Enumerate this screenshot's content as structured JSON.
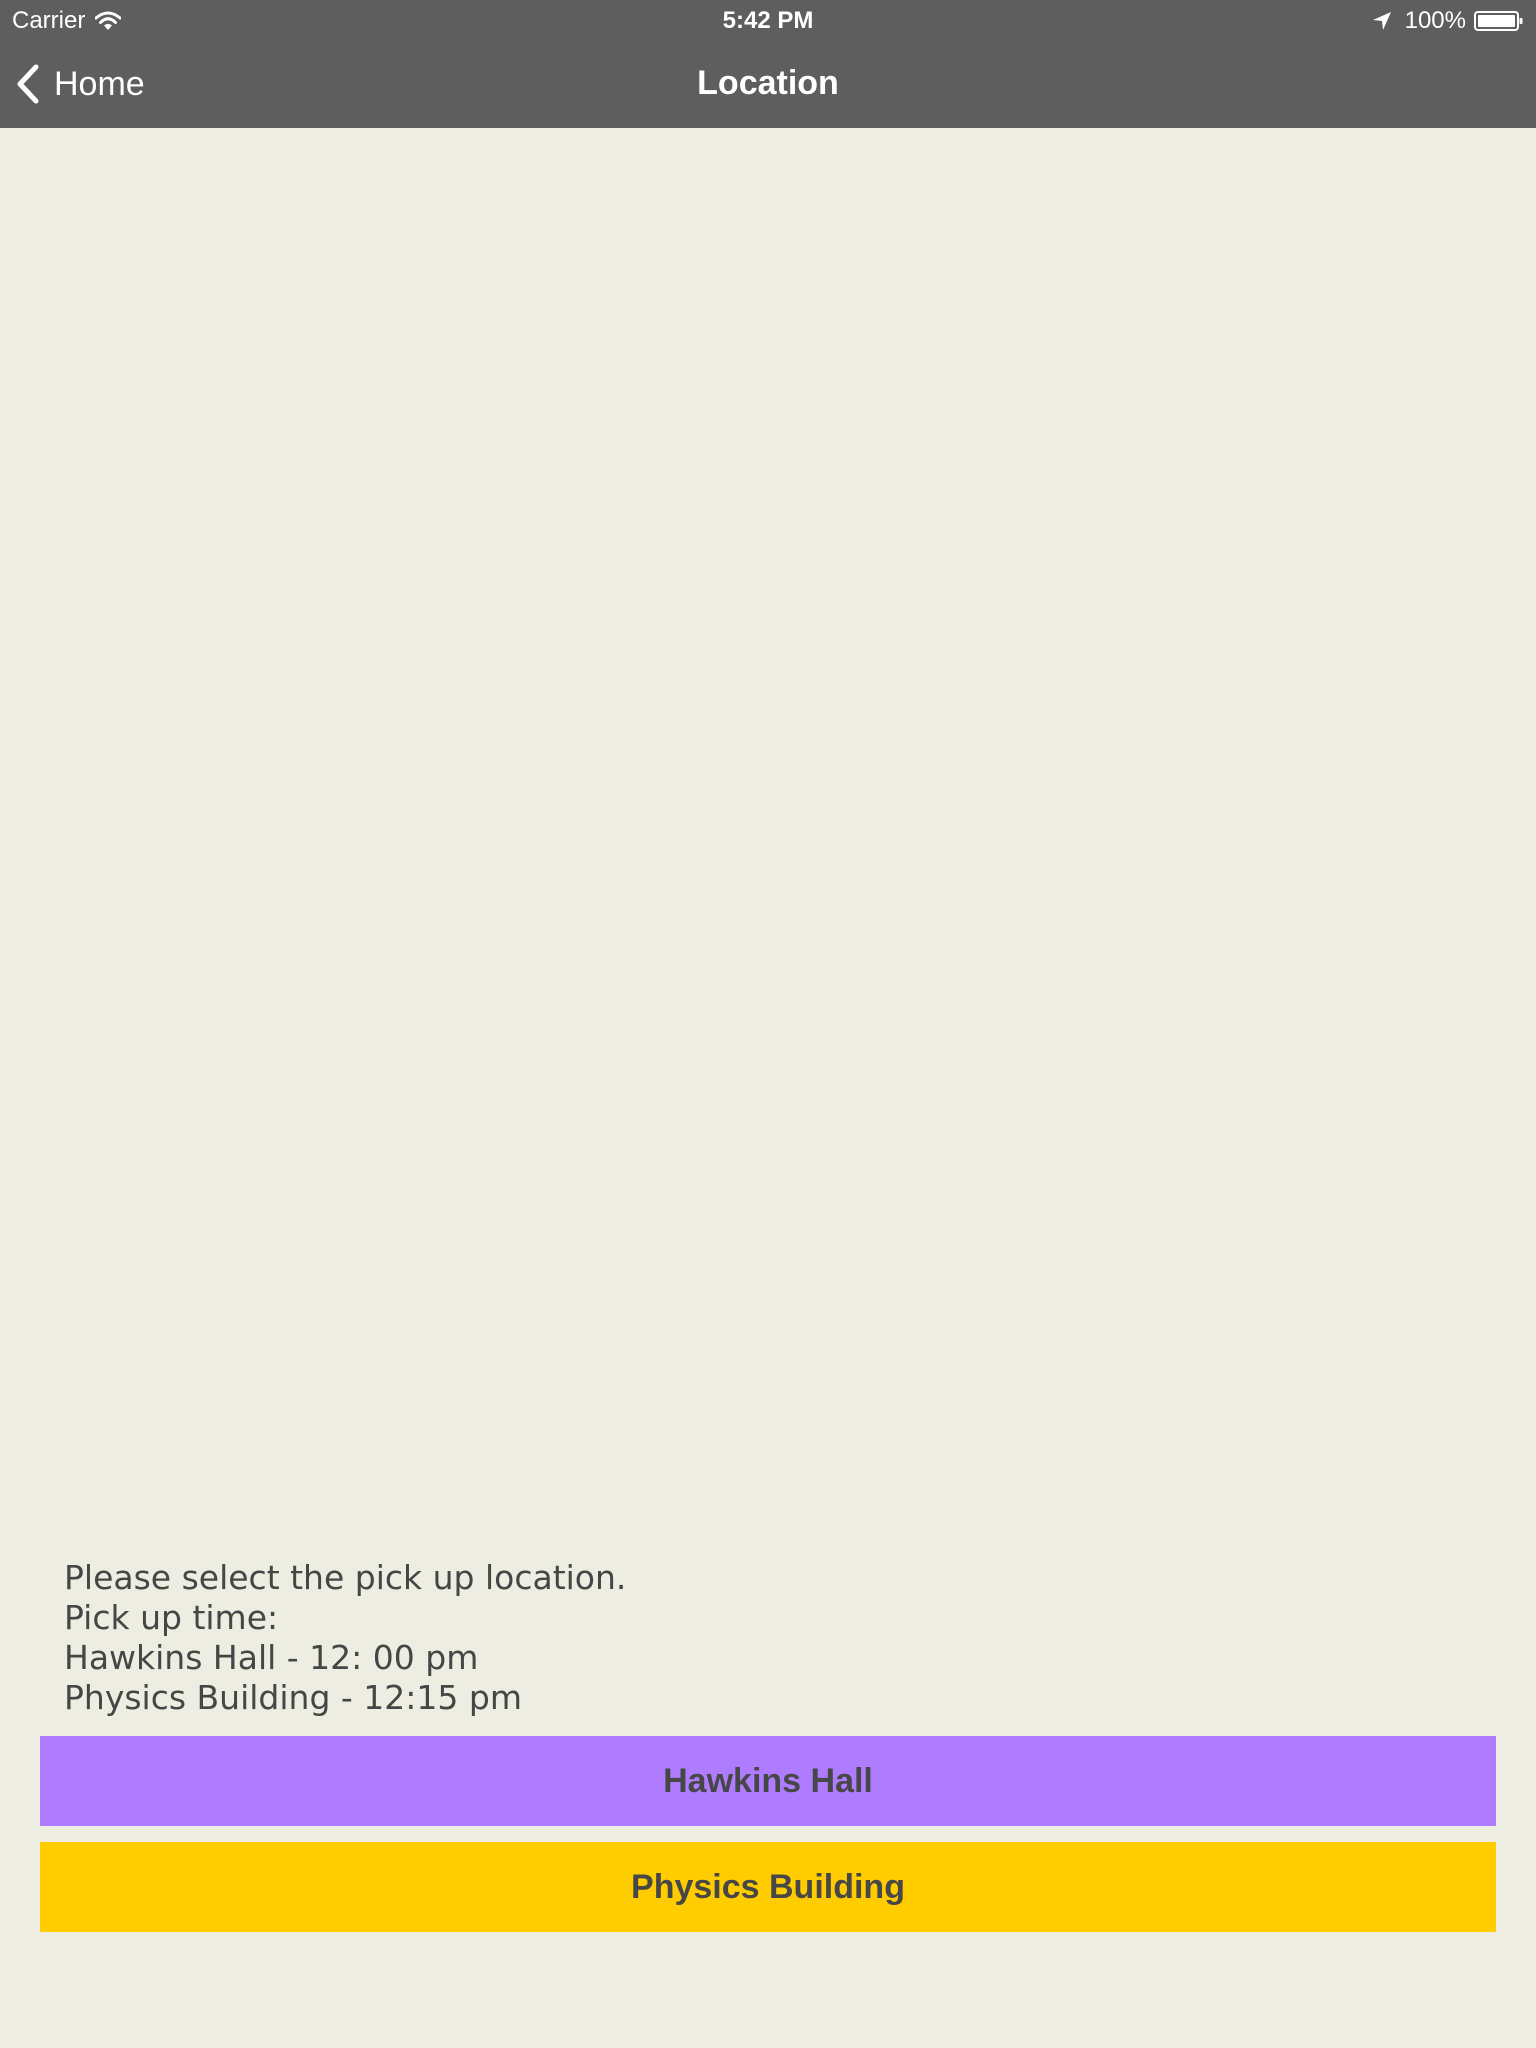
{
  "status_bar": {
    "carrier": "Carrier",
    "time": "5:42 PM",
    "battery": "100%",
    "icons": [
      "wifi-icon",
      "location-arrow-icon",
      "battery-icon"
    ]
  },
  "nav": {
    "back_label": "Home",
    "title": "Location"
  },
  "instructions": {
    "line1": "Please select the pick up location.",
    "line2": "Pick up time:",
    "line3": "Hawkins Hall - 12: 00 pm",
    "line4": "Physics Building - 12:15 pm"
  },
  "buttons": {
    "hawkins_label": "Hawkins Hall",
    "physics_label": "Physics Building"
  },
  "colors": {
    "nav_bar": "#5E5E5E",
    "background": "#EDEDE1",
    "hawkins_button": "#B07CFF",
    "physics_button": "#FFCC00",
    "button_text": "#474747"
  }
}
